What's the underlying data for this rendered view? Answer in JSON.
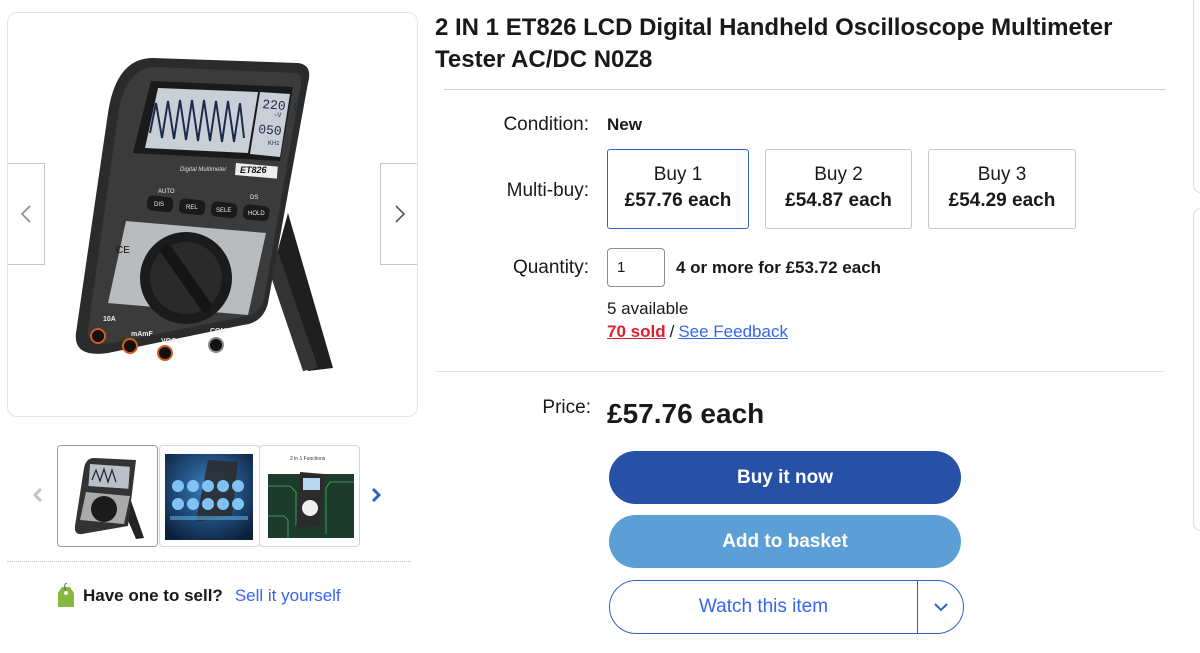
{
  "gallery": {
    "main_image_alt": "ET826 LCD digital handheld oscilloscope multimeter",
    "device_screen": {
      "reading_primary": "220.0",
      "reading_unit": "~V",
      "reading_secondary": "050",
      "reading_secondary_unit": "KHz"
    },
    "device_labels": {
      "brand": "Digital Multimeter",
      "model": "ET826",
      "key1": "DIS",
      "key2": "REL",
      "key3": "SELE",
      "key4": "HOLD",
      "port1": "10A",
      "port2": "mAmF",
      "port3": "VΩCap",
      "port4": "COM",
      "top1": "AUTO",
      "top2": "DS"
    },
    "thumbnails": [
      "thumbnail-1",
      "thumbnail-2",
      "thumbnail-3"
    ],
    "thumb3_caption": "2 in 1 Functions"
  },
  "sell": {
    "question": "Have one to sell?",
    "link": "Sell it yourself"
  },
  "listing": {
    "title": "2 IN 1 ET826 LCD Digital Handheld Oscilloscope Multimeter Tester AC/DC N0Z8",
    "condition_label": "Condition:",
    "condition_value": "New",
    "multibuy_label": "Multi-buy:",
    "tiers": [
      {
        "name": "Buy 1",
        "price": "£57.76 each",
        "selected": true
      },
      {
        "name": "Buy 2",
        "price": "£54.87 each",
        "selected": false
      },
      {
        "name": "Buy 3",
        "price": "£54.29 each",
        "selected": false
      }
    ],
    "quantity_label": "Quantity:",
    "quantity_value": "1",
    "bulk_offer": "4 or more for £53.72 each",
    "available": "5 available",
    "sold": "70 sold",
    "separator": "/",
    "feedback": "See Feedback",
    "price_label": "Price:",
    "price_value": "£57.76 each"
  },
  "actions": {
    "buy_now": "Buy it now",
    "add_basket": "Add to basket",
    "watch": "Watch this item"
  },
  "colors": {
    "primary": "#2751a7",
    "secondary": "#5b9fd6",
    "link": "#3665f3",
    "sold": "#dd1e31"
  }
}
